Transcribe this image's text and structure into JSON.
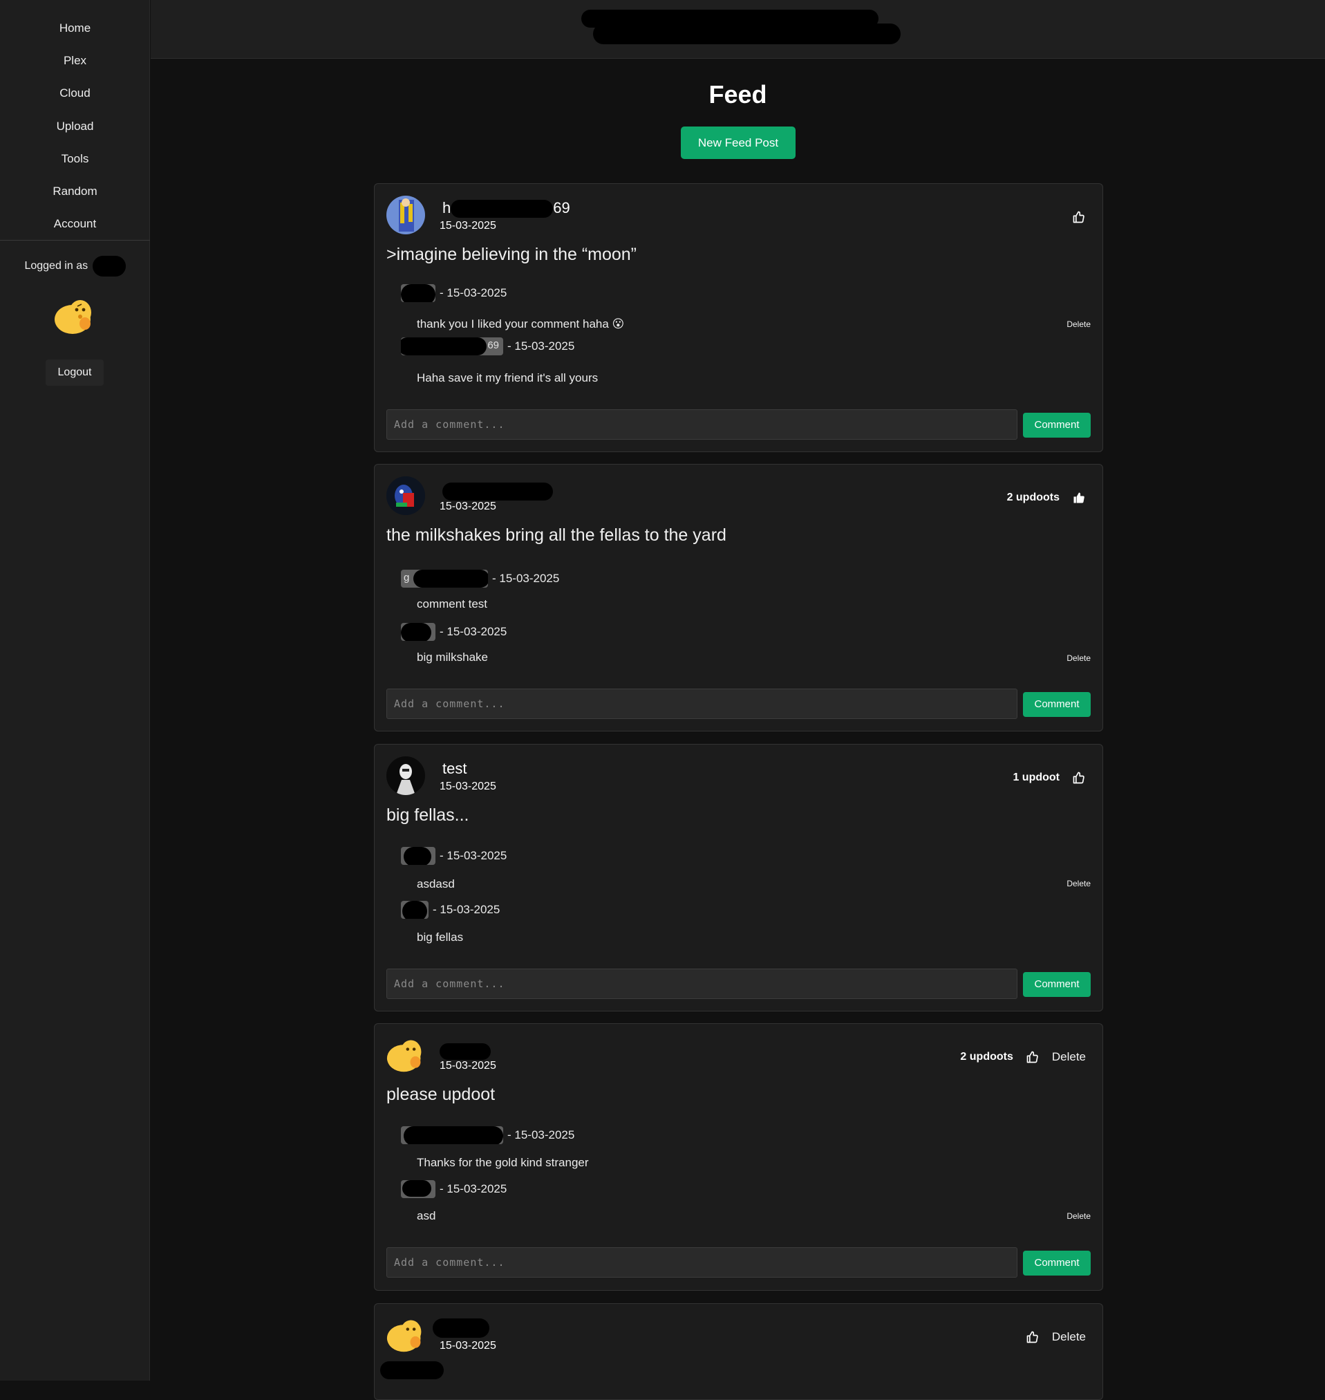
{
  "sidebar": {
    "nav": [
      "Home",
      "Plex",
      "Cloud",
      "Upload",
      "Tools",
      "Random",
      "Account"
    ],
    "logged_in_label": "Logged in as",
    "logout_label": "Logout",
    "avatar_icon": "thinking-blob-emoji"
  },
  "page": {
    "title": "Feed",
    "new_post_label": "New Feed Post"
  },
  "comment_placeholder": "Add a comment...",
  "comment_button_label": "Comment",
  "delete_label": "Delete",
  "posts": [
    {
      "author_visible": "h",
      "author_suffix": "69",
      "date": "15-03-2025",
      "content": ">imagine believing in the “moon”",
      "updoots": "",
      "comments": [
        {
          "name_visible": "",
          "date": "- 15-03-2025",
          "text": "thank you I liked your comment haha 😮",
          "deletable": true
        },
        {
          "name_visible": "69",
          "date": "- 15-03-2025",
          "text": "Haha save it my friend it's all yours",
          "deletable": false
        }
      ]
    },
    {
      "author_visible": "",
      "author_suffix": "",
      "date": "15-03-2025",
      "content": "the milkshakes bring all the fellas to the yard",
      "updoots": "2 updoots",
      "comments": [
        {
          "name_visible": "g",
          "date": "- 15-03-2025",
          "text": "comment test",
          "deletable": false
        },
        {
          "name_visible": "",
          "date": "- 15-03-2025",
          "text": "big milkshake",
          "deletable": true
        }
      ]
    },
    {
      "author_visible": "test",
      "author_suffix": "",
      "date": "15-03-2025",
      "content": "big fellas...",
      "updoots": "1 updoot",
      "comments": [
        {
          "name_visible": "",
          "date": "- 15-03-2025",
          "text": "asdasd",
          "deletable": true
        },
        {
          "name_visible": "",
          "date": "- 15-03-2025",
          "text": "big fellas",
          "deletable": false
        }
      ]
    },
    {
      "author_visible": "",
      "author_suffix": "",
      "date": "15-03-2025",
      "content": "please updoot",
      "updoots": "2 updoots",
      "comments": [
        {
          "name_visible": "",
          "date": "- 15-03-2025",
          "text": "Thanks for the gold kind stranger",
          "deletable": false
        },
        {
          "name_visible": "",
          "date": "- 15-03-2025",
          "text": "asd",
          "deletable": true
        }
      ]
    },
    {
      "author_visible": "",
      "author_suffix": "",
      "date": "15-03-2025",
      "content": "",
      "updoots": "",
      "comments": []
    }
  ],
  "colors": {
    "accent": "#0ea86a",
    "background": "#111111",
    "panel": "#1c1c1c"
  }
}
